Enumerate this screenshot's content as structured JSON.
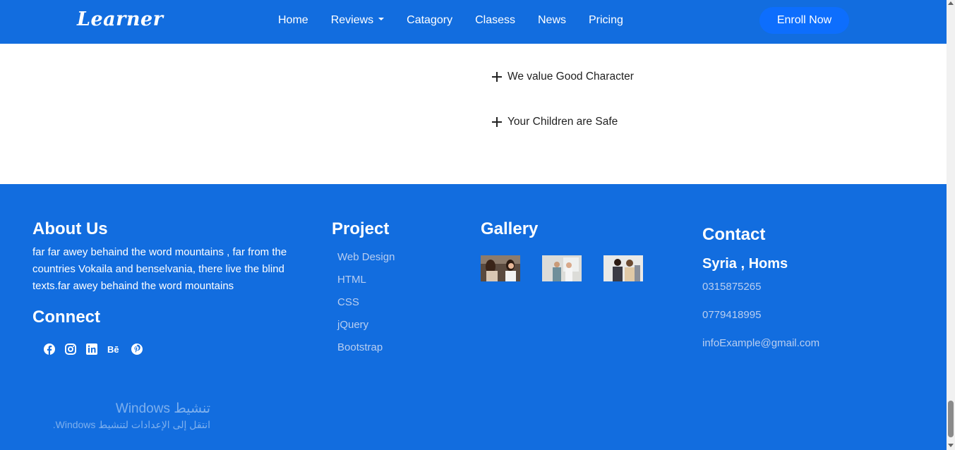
{
  "nav": {
    "logo": "Learner",
    "links": [
      "Home",
      "Reviews",
      "Catagory",
      "Clasess",
      "News",
      "Pricing"
    ],
    "enroll": "Enroll Now"
  },
  "values": [
    "We value Good Character",
    "Your Children are Safe"
  ],
  "footer": {
    "about_heading": "About Us",
    "about_text": "far far awey behaind the word mountains , far from the countries Vokaila and benselvania, there live the blind texts.far awey behaind the word mountains",
    "connect_heading": "Connect",
    "social_icons": [
      "facebook-icon",
      "instagram-icon",
      "linkedin-icon",
      "behance-icon",
      "pinterest-icon"
    ],
    "project_heading": "Project",
    "project_items": [
      "Web Design",
      "HTML",
      "CSS",
      "jQuery",
      "Bootstrap"
    ],
    "gallery_heading": "Gallery",
    "contact_heading": "Contact",
    "contact_city": "Syria , Homs",
    "phone1": "0315875265",
    "phone2": "0779418995",
    "email": "infoExample@gmail.com"
  },
  "watermark": {
    "title": "تنشيط Windows",
    "subtitle": "انتقل إلى الإعدادات لتنشيط Windows."
  },
  "colors": {
    "primary": "#126ddf",
    "button": "#0d6efd",
    "link_muted": "#b9cef0"
  }
}
